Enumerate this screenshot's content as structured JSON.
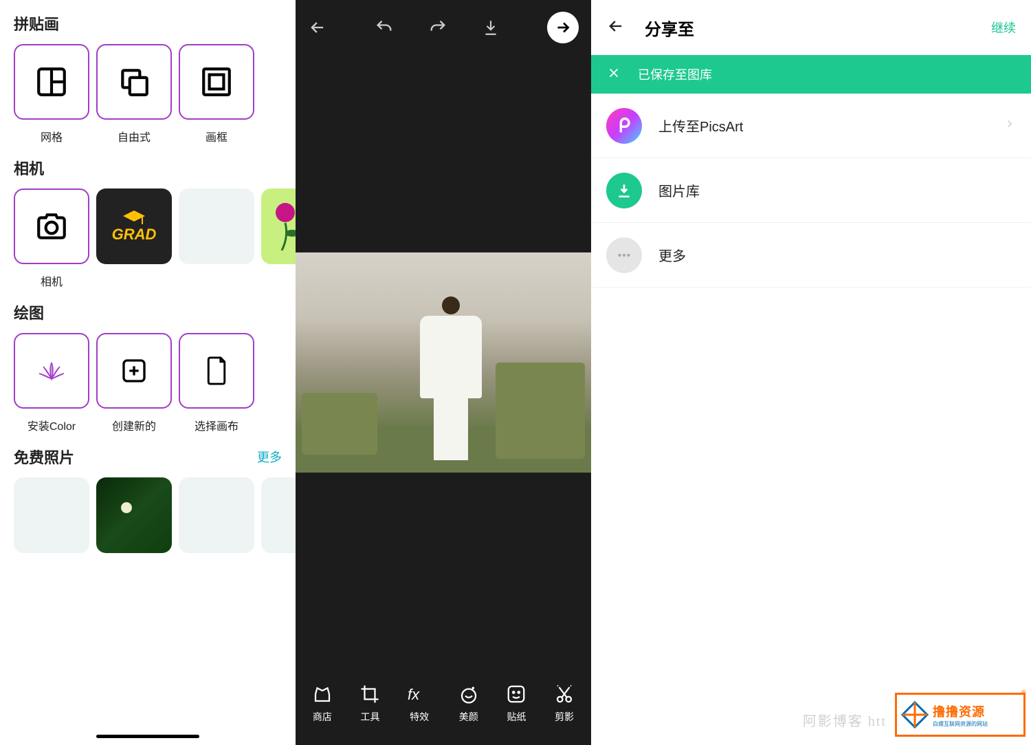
{
  "left": {
    "sections": {
      "collage": {
        "title": "拼贴画",
        "items": {
          "grid": "网格",
          "freestyle": "自由式",
          "frame": "画框"
        }
      },
      "camera": {
        "title": "相机",
        "items": {
          "camera": "相机"
        }
      },
      "draw": {
        "title": "绘图",
        "items": {
          "install_color": "安装Color",
          "create_new": "创建新的",
          "select_canvas": "选择画布"
        }
      },
      "free_photos": {
        "title": "免费照片",
        "more": "更多"
      }
    }
  },
  "editor": {
    "tools": {
      "shop": "商店",
      "tools": "工具",
      "fx": "特效",
      "beauty": "美颜",
      "sticker": "贴纸",
      "cutout": "剪影"
    }
  },
  "share": {
    "title": "分享至",
    "continue": "继续",
    "saved_banner": "已保存至图库",
    "items": {
      "picsart": "上传至PicsArt",
      "gallery": "图片库",
      "more": "更多"
    }
  },
  "watermark": {
    "text": "阿影博客 htt",
    "brand_big": "撸撸资源",
    "brand_small": "白嫖互联网资源的网站"
  },
  "misc": {
    "grad_text": "GRAD"
  }
}
